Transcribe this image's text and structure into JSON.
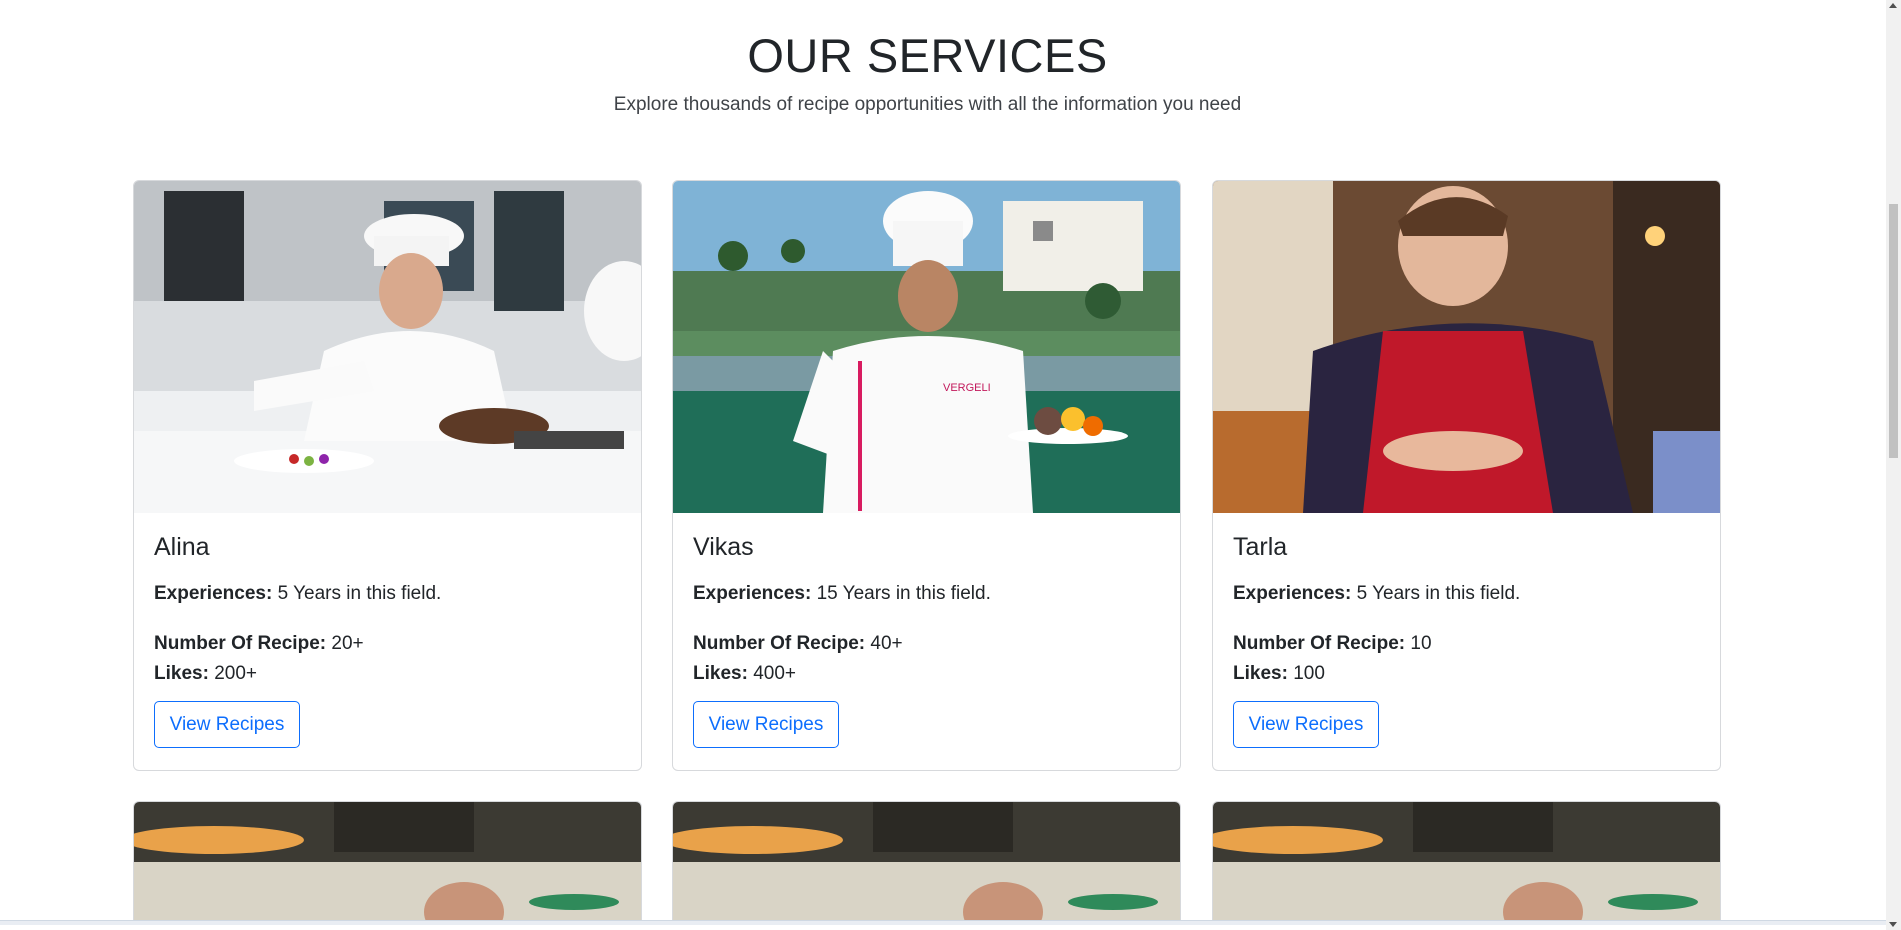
{
  "section": {
    "title": "OUR SERVICES",
    "subtitle": "Explore thousands of recipe opportunities with all the information you need"
  },
  "labels": {
    "experiences": "Experiences:",
    "recipes": "Number Of Recipe:",
    "likes": "Likes:"
  },
  "chefs": [
    {
      "name": "Alina",
      "experience": "5 Years in this field.",
      "recipes": "20+",
      "likes": "200+",
      "button": "View Recipes"
    },
    {
      "name": "Vikas",
      "experience": "15 Years in this field.",
      "recipes": "40+",
      "likes": "400+",
      "button": "View Recipes"
    },
    {
      "name": "Tarla",
      "experience": "5 Years in this field.",
      "recipes": "10",
      "likes": "100",
      "button": "View Recipes"
    }
  ],
  "colors": {
    "button_accent": "#0d6efd",
    "card_border": "#d7d9dc"
  }
}
